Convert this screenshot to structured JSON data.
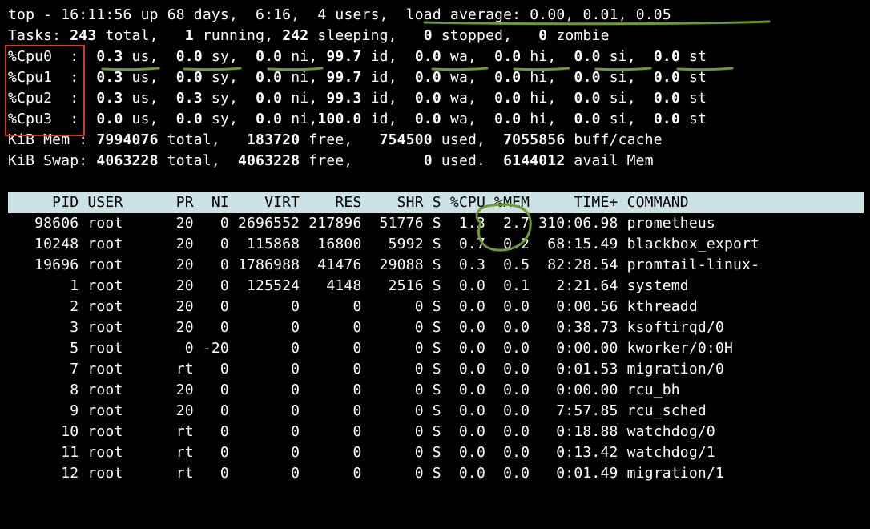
{
  "top_line": {
    "prefix": "top - ",
    "time": "16:11:56",
    "up_label": " up ",
    "uptime": "68 days,  6:16",
    "sep1": ",  ",
    "users": "4 users",
    "sep2": ",  ",
    "load_label": "load average: ",
    "load": "0.00, 0.01, 0.05"
  },
  "tasks": {
    "label": "Tasks: ",
    "total": "243",
    "total_lbl": " total,   ",
    "running": "1",
    "running_lbl": " running, ",
    "sleeping": "242",
    "sleeping_lbl": " sleeping,   ",
    "stopped": "0",
    "stopped_lbl": " stopped,   ",
    "zombie": "0",
    "zombie_lbl": " zombie"
  },
  "cpus": [
    {
      "name": "%Cpu0  ",
      "us": "0.3",
      "sy": "0.0",
      "ni": "0.0",
      "id": "99.7",
      "wa": "0.0",
      "hi": "0.0",
      "si": "0.0",
      "st": "0.0"
    },
    {
      "name": "%Cpu1  ",
      "us": "0.3",
      "sy": "0.0",
      "ni": "0.0",
      "id": "99.7",
      "wa": "0.0",
      "hi": "0.0",
      "si": "0.0",
      "st": "0.0"
    },
    {
      "name": "%Cpu2  ",
      "us": "0.3",
      "sy": "0.3",
      "ni": "0.0",
      "id": "99.3",
      "wa": "0.0",
      "hi": "0.0",
      "si": "0.0",
      "st": "0.0"
    },
    {
      "name": "%Cpu3  ",
      "us": "0.0",
      "sy": "0.0",
      "ni": "0.0",
      "id": "100.0",
      "wa": "0.0",
      "hi": "0.0",
      "si": "0.0",
      "st": "0.0"
    }
  ],
  "mem": {
    "label": "KiB Mem : ",
    "total": "7994076",
    "total_lbl": " total,   ",
    "free": "183720",
    "free_lbl": " free,   ",
    "used": "754500",
    "used_lbl": " used,  ",
    "buff": "7055856",
    "buff_lbl": " buff/cache"
  },
  "swap": {
    "label": "KiB Swap: ",
    "total": "4063228",
    "total_lbl": " total,  ",
    "free": "4063228",
    "free_lbl": " free,        ",
    "used": "0",
    "used_lbl": " used.  ",
    "avail": "6144012",
    "avail_lbl": " avail Mem "
  },
  "columns": {
    "pid": "PID",
    "user": "USER",
    "pr": "PR",
    "ni": "NI",
    "virt": "VIRT",
    "res": "RES",
    "shr": "SHR",
    "s": "S",
    "cpu": "%CPU",
    "mem": "%MEM",
    "time": "TIME+",
    "cmd": "COMMAND"
  },
  "procs": [
    {
      "pid": "98606",
      "user": "root",
      "pr": "20",
      "ni": "0",
      "virt": "2696552",
      "res": "217896",
      "shr": "51776",
      "s": "S",
      "cpu": "1.3",
      "mem": "2.7",
      "time": "310:06.98",
      "cmd": "prometheus"
    },
    {
      "pid": "10248",
      "user": "root",
      "pr": "20",
      "ni": "0",
      "virt": "115868",
      "res": "16800",
      "shr": "5992",
      "s": "S",
      "cpu": "0.7",
      "mem": "0.2",
      "time": "68:15.49",
      "cmd": "blackbox_export"
    },
    {
      "pid": "19696",
      "user": "root",
      "pr": "20",
      "ni": "0",
      "virt": "1786988",
      "res": "41476",
      "shr": "29088",
      "s": "S",
      "cpu": "0.3",
      "mem": "0.5",
      "time": "82:28.54",
      "cmd": "promtail-linux-"
    },
    {
      "pid": "1",
      "user": "root",
      "pr": "20",
      "ni": "0",
      "virt": "125524",
      "res": "4148",
      "shr": "2516",
      "s": "S",
      "cpu": "0.0",
      "mem": "0.1",
      "time": "2:21.64",
      "cmd": "systemd"
    },
    {
      "pid": "2",
      "user": "root",
      "pr": "20",
      "ni": "0",
      "virt": "0",
      "res": "0",
      "shr": "0",
      "s": "S",
      "cpu": "0.0",
      "mem": "0.0",
      "time": "0:00.56",
      "cmd": "kthreadd"
    },
    {
      "pid": "3",
      "user": "root",
      "pr": "20",
      "ni": "0",
      "virt": "0",
      "res": "0",
      "shr": "0",
      "s": "S",
      "cpu": "0.0",
      "mem": "0.0",
      "time": "0:38.73",
      "cmd": "ksoftirqd/0"
    },
    {
      "pid": "5",
      "user": "root",
      "pr": "0",
      "ni": "-20",
      "virt": "0",
      "res": "0",
      "shr": "0",
      "s": "S",
      "cpu": "0.0",
      "mem": "0.0",
      "time": "0:00.00",
      "cmd": "kworker/0:0H"
    },
    {
      "pid": "7",
      "user": "root",
      "pr": "rt",
      "ni": "0",
      "virt": "0",
      "res": "0",
      "shr": "0",
      "s": "S",
      "cpu": "0.0",
      "mem": "0.0",
      "time": "0:01.53",
      "cmd": "migration/0"
    },
    {
      "pid": "8",
      "user": "root",
      "pr": "20",
      "ni": "0",
      "virt": "0",
      "res": "0",
      "shr": "0",
      "s": "S",
      "cpu": "0.0",
      "mem": "0.0",
      "time": "0:00.00",
      "cmd": "rcu_bh"
    },
    {
      "pid": "9",
      "user": "root",
      "pr": "20",
      "ni": "0",
      "virt": "0",
      "res": "0",
      "shr": "0",
      "s": "S",
      "cpu": "0.0",
      "mem": "0.0",
      "time": "7:57.85",
      "cmd": "rcu_sched"
    },
    {
      "pid": "10",
      "user": "root",
      "pr": "rt",
      "ni": "0",
      "virt": "0",
      "res": "0",
      "shr": "0",
      "s": "S",
      "cpu": "0.0",
      "mem": "0.0",
      "time": "0:18.88",
      "cmd": "watchdog/0"
    },
    {
      "pid": "11",
      "user": "root",
      "pr": "rt",
      "ni": "0",
      "virt": "0",
      "res": "0",
      "shr": "0",
      "s": "S",
      "cpu": "0.0",
      "mem": "0.0",
      "time": "0:13.42",
      "cmd": "watchdog/1"
    },
    {
      "pid": "12",
      "user": "root",
      "pr": "rt",
      "ni": "0",
      "virt": "0",
      "res": "0",
      "shr": "0",
      "s": "S",
      "cpu": "0.0",
      "mem": "0.0",
      "time": "0:01.49",
      "cmd": "migration/1"
    }
  ]
}
